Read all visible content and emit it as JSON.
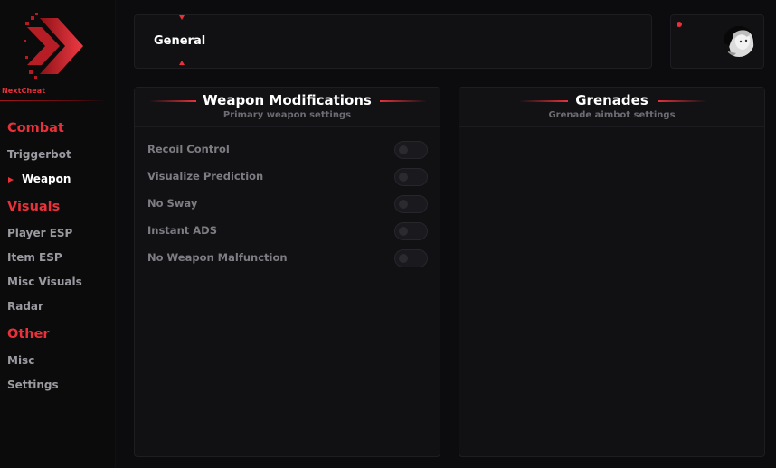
{
  "brand": {
    "name": "NextCheat",
    "accent": "#e8313a"
  },
  "sidebar": {
    "sections": [
      {
        "title": "Combat",
        "items": [
          "Triggerbot",
          "Weapon"
        ]
      },
      {
        "title": "Visuals",
        "items": [
          "Player ESP",
          "Item ESP",
          "Misc Visuals",
          "Radar"
        ]
      },
      {
        "title": "Other",
        "items": [
          "Misc",
          "Settings"
        ]
      }
    ],
    "active_item": "Weapon"
  },
  "tabs": {
    "current": "General"
  },
  "user": {
    "online_status_color": "#e8313a",
    "avatar_icon": "anime-avatar-icon"
  },
  "panels": {
    "weapon": {
      "title": "Weapon Modifications",
      "subtitle": "Primary weapon settings",
      "settings": [
        {
          "label": "Recoil Control",
          "enabled": false
        },
        {
          "label": "Visualize Prediction",
          "enabled": false
        },
        {
          "label": "No Sway",
          "enabled": false
        },
        {
          "label": "Instant ADS",
          "enabled": false
        },
        {
          "label": "No Weapon Malfunction",
          "enabled": false
        }
      ]
    },
    "grenades": {
      "title": "Grenades",
      "subtitle": "Grenade aimbot settings"
    }
  }
}
